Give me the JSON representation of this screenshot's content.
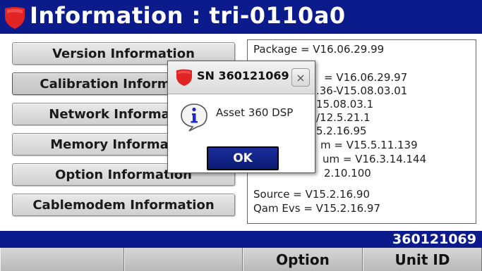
{
  "window": {
    "title": "Information : tri-0110a0",
    "logo_icon": "shield-icon",
    "brand_color": "#0b1b8c",
    "logo_color": "#e02424"
  },
  "nav": {
    "items": [
      {
        "label": "Version Information"
      },
      {
        "label": "Calibration Information"
      },
      {
        "label": "Network Information"
      },
      {
        "label": "Memory Information"
      },
      {
        "label": "Option Information"
      },
      {
        "label": "Cablemodem Information"
      }
    ]
  },
  "info": {
    "lines": [
      "Package = V16.06.29.99",
      "",
      "= V16.06.29.97",
      ".36-V15.08.03.01",
      "15.08.03.1",
      "/12.5.21.1",
      "5.2.16.95",
      "m = V15.5.11.139",
      "um = V16.3.14.144",
      "2.10.100",
      "Source = V15.2.16.90",
      "Qam Evs = V15.2.16.97"
    ]
  },
  "status": {
    "serial": "360121069"
  },
  "softkeys": [
    {
      "label": ""
    },
    {
      "label": ""
    },
    {
      "label": "Option"
    },
    {
      "label": "Unit ID"
    }
  ],
  "dialog": {
    "title": "SN 360121069",
    "close_label": "×",
    "message": "Asset 360 DSP",
    "ok_label": "OK",
    "icon": "info-icon"
  }
}
